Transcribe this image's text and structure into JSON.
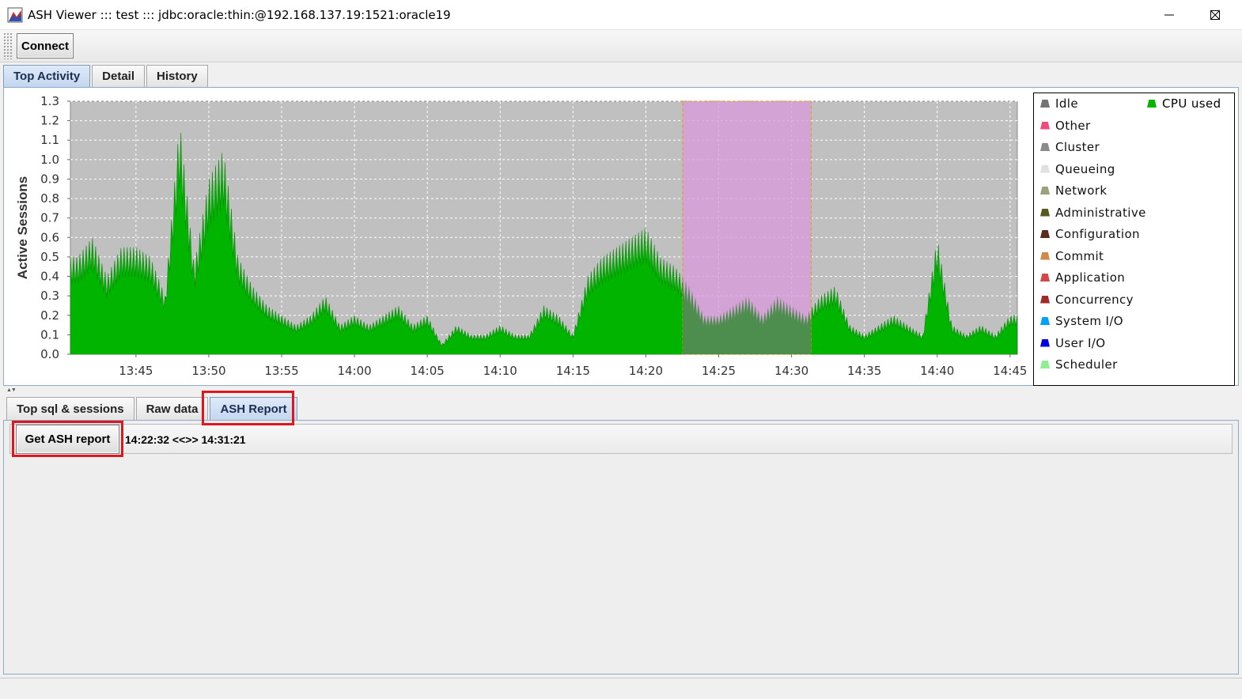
{
  "window": {
    "title": "ASH Viewer ::: test ::: jdbc:oracle:thin:@192.168.137.19:1521:oracle19",
    "controls": [
      "minimize",
      "maximize",
      "close"
    ]
  },
  "toolbar": {
    "connect_label": "Connect"
  },
  "main_tabs": [
    {
      "label": "Top Activity",
      "active": true
    },
    {
      "label": "Detail",
      "active": false
    },
    {
      "label": "History",
      "active": false
    }
  ],
  "chart": {
    "ylabel": "Active Sessions",
    "x_ticks": [
      "13:45",
      "13:50",
      "13:55",
      "14:00",
      "14:05",
      "14:10",
      "14:15",
      "14:20",
      "14:25",
      "14:30",
      "14:35",
      "14:40",
      "14:45"
    ],
    "y_ticks": [
      "0.0",
      "0.1",
      "0.2",
      "0.3",
      "0.4",
      "0.5",
      "0.6",
      "0.7",
      "0.8",
      "0.9",
      "1.0",
      "1.1",
      "1.2",
      "1.3"
    ],
    "selection": {
      "start": "14:22:32",
      "end": "14:31:21"
    },
    "colors": {
      "background": "#c0c0c0",
      "cpu": "#00b400",
      "selection": "#d99bdd"
    }
  },
  "chart_data": {
    "type": "area",
    "ylabel": "Active Sessions",
    "ylim": [
      0,
      1.3
    ],
    "xlim": [
      "13:40:30",
      "14:45:30"
    ],
    "grid": true,
    "legend_position": "right",
    "series": [
      {
        "name": "CPU used",
        "color": "#00b400",
        "x": [
          "13:41",
          "13:42",
          "13:43",
          "13:44",
          "13:45",
          "13:46",
          "13:47",
          "13:48",
          "13:49",
          "13:50",
          "13:51",
          "13:52",
          "13:53",
          "13:54",
          "13:55",
          "13:56",
          "13:57",
          "13:58",
          "13:59",
          "14:00",
          "14:01",
          "14:02",
          "14:03",
          "14:04",
          "14:05",
          "14:06",
          "14:07",
          "14:08",
          "14:09",
          "14:10",
          "14:11",
          "14:12",
          "14:13",
          "14:14",
          "14:15",
          "14:16",
          "14:17",
          "14:18",
          "14:19",
          "14:20",
          "14:21",
          "14:22",
          "14:23",
          "14:24",
          "14:25",
          "14:26",
          "14:27",
          "14:28",
          "14:29",
          "14:30",
          "14:31",
          "14:32",
          "14:33",
          "14:34",
          "14:35",
          "14:36",
          "14:37",
          "14:38",
          "14:39",
          "14:40",
          "14:41",
          "14:42",
          "14:43",
          "14:44",
          "14:45"
        ],
        "values": [
          0.5,
          0.6,
          0.4,
          0.55,
          0.55,
          0.5,
          0.3,
          1.2,
          0.45,
          0.9,
          1.05,
          0.5,
          0.35,
          0.25,
          0.2,
          0.15,
          0.2,
          0.3,
          0.15,
          0.2,
          0.15,
          0.2,
          0.25,
          0.15,
          0.2,
          0.05,
          0.15,
          0.1,
          0.1,
          0.15,
          0.1,
          0.1,
          0.25,
          0.2,
          0.1,
          0.4,
          0.5,
          0.55,
          0.6,
          0.65,
          0.5,
          0.45,
          0.35,
          0.2,
          0.2,
          0.25,
          0.3,
          0.2,
          0.3,
          0.25,
          0.2,
          0.3,
          0.35,
          0.15,
          0.1,
          0.15,
          0.2,
          0.15,
          0.1,
          0.6,
          0.15,
          0.1,
          0.15,
          0.1,
          0.2
        ]
      },
      {
        "name": "User I/O",
        "color": "#0000ff",
        "values_note": ""
      },
      {
        "name": "System I/O",
        "color": "#00a0ff"
      },
      {
        "name": "Other",
        "color": "#f04a7c"
      }
    ]
  },
  "legend": {
    "items": [
      {
        "label": "Idle",
        "color": "#747474"
      },
      {
        "label": "Other",
        "color": "#f04a7c"
      },
      {
        "label": "Cluster",
        "color": "#8a8a8a"
      },
      {
        "label": "Queueing",
        "color": "#e0e0e0"
      },
      {
        "label": "Network",
        "color": "#9aa27a"
      },
      {
        "label": "Administrative",
        "color": "#5a5a1e"
      },
      {
        "label": "Configuration",
        "color": "#5a2a1e"
      },
      {
        "label": "Commit",
        "color": "#d08a4a"
      },
      {
        "label": "Application",
        "color": "#d04848"
      },
      {
        "label": "Concurrency",
        "color": "#a02a2a"
      },
      {
        "label": "System I/O",
        "color": "#00a0ff"
      },
      {
        "label": "User I/O",
        "color": "#0000e0"
      },
      {
        "label": "Scheduler",
        "color": "#90ee90"
      }
    ],
    "cpu": {
      "label": "CPU used",
      "color": "#00b400"
    }
  },
  "bottom_tabs": [
    {
      "label": "Top sql & sessions",
      "active": false
    },
    {
      "label": "Raw data",
      "active": false
    },
    {
      "label": "ASH Report",
      "active": true
    }
  ],
  "report": {
    "button_label": "Get ASH report",
    "range_text": "14:22:32 <<>> 14:31:21"
  }
}
